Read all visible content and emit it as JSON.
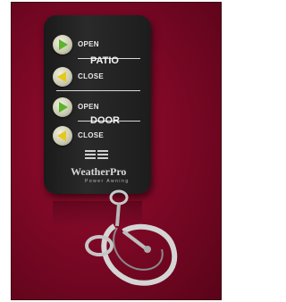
{
  "remote": {
    "groups": [
      {
        "name": "PATIO",
        "open_label": "OPEN",
        "close_label": "CLOSE"
      },
      {
        "name": "DOOR",
        "open_label": "OPEN",
        "close_label": "CLOSE"
      }
    ],
    "logo_text": "WeatherPro",
    "logo_subtext": "Power Awning"
  },
  "colors": {
    "background": "#7d0826",
    "remote_body": "#1c1c1c",
    "open_arrow": "#5bb52a",
    "close_arrow": "#e6c819",
    "button": "#e6e6d6",
    "text": "#e8e8e8"
  },
  "icons": [
    "play-right-icon",
    "play-left-icon",
    "keychain-icon"
  ]
}
